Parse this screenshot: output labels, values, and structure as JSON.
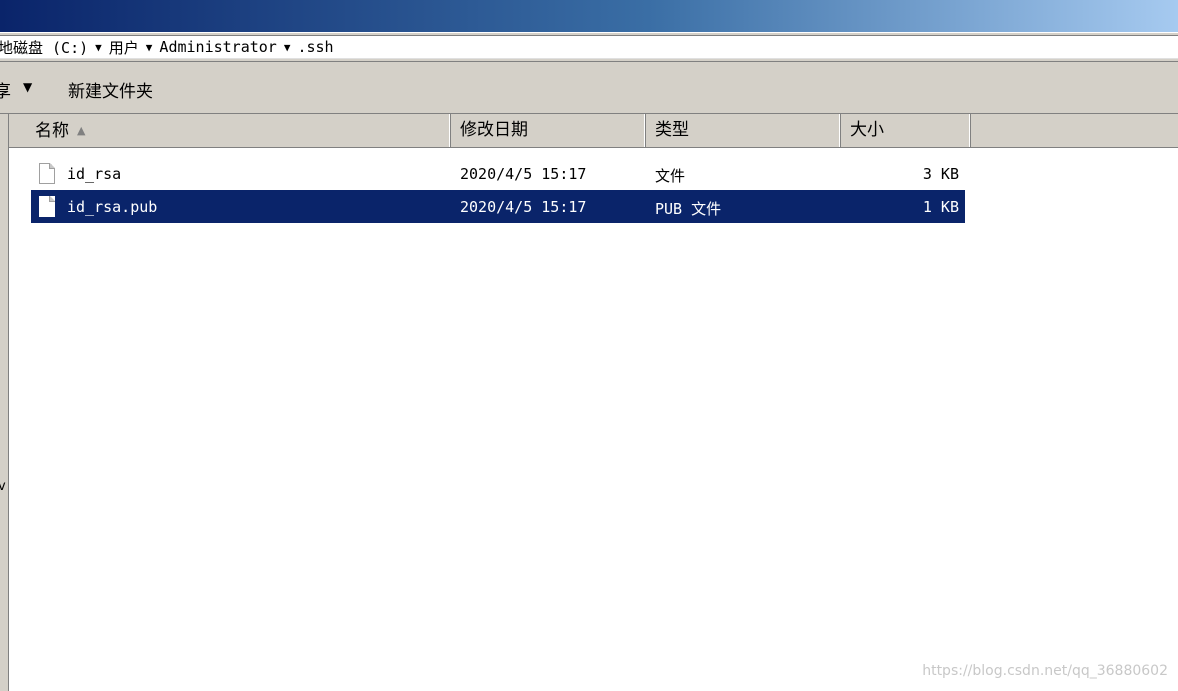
{
  "address": {
    "crumbs": [
      "地磁盘 (C:)",
      "用户",
      "Administrator",
      ".ssh"
    ],
    "separator_glyph": "▼"
  },
  "toolbar": {
    "share_label": "享",
    "share_arrow": "▼",
    "new_folder_label": "新建文件夹"
  },
  "left_pane": {
    "glyph": "v"
  },
  "columns": {
    "name": "名称",
    "date": "修改日期",
    "type": "类型",
    "size": "大小",
    "sort_glyph": "▲"
  },
  "files": [
    {
      "name": "id_rsa",
      "modified": "2020/4/5 15:17",
      "type": "文件",
      "size": "3 KB",
      "selected": false
    },
    {
      "name": "id_rsa.pub",
      "modified": "2020/4/5 15:17",
      "type": "PUB 文件",
      "size": "1 KB",
      "selected": true
    }
  ],
  "colors": {
    "selection": "#0a246a",
    "chrome": "#d4d0c8"
  },
  "watermark": "https://blog.csdn.net/qq_36880602"
}
